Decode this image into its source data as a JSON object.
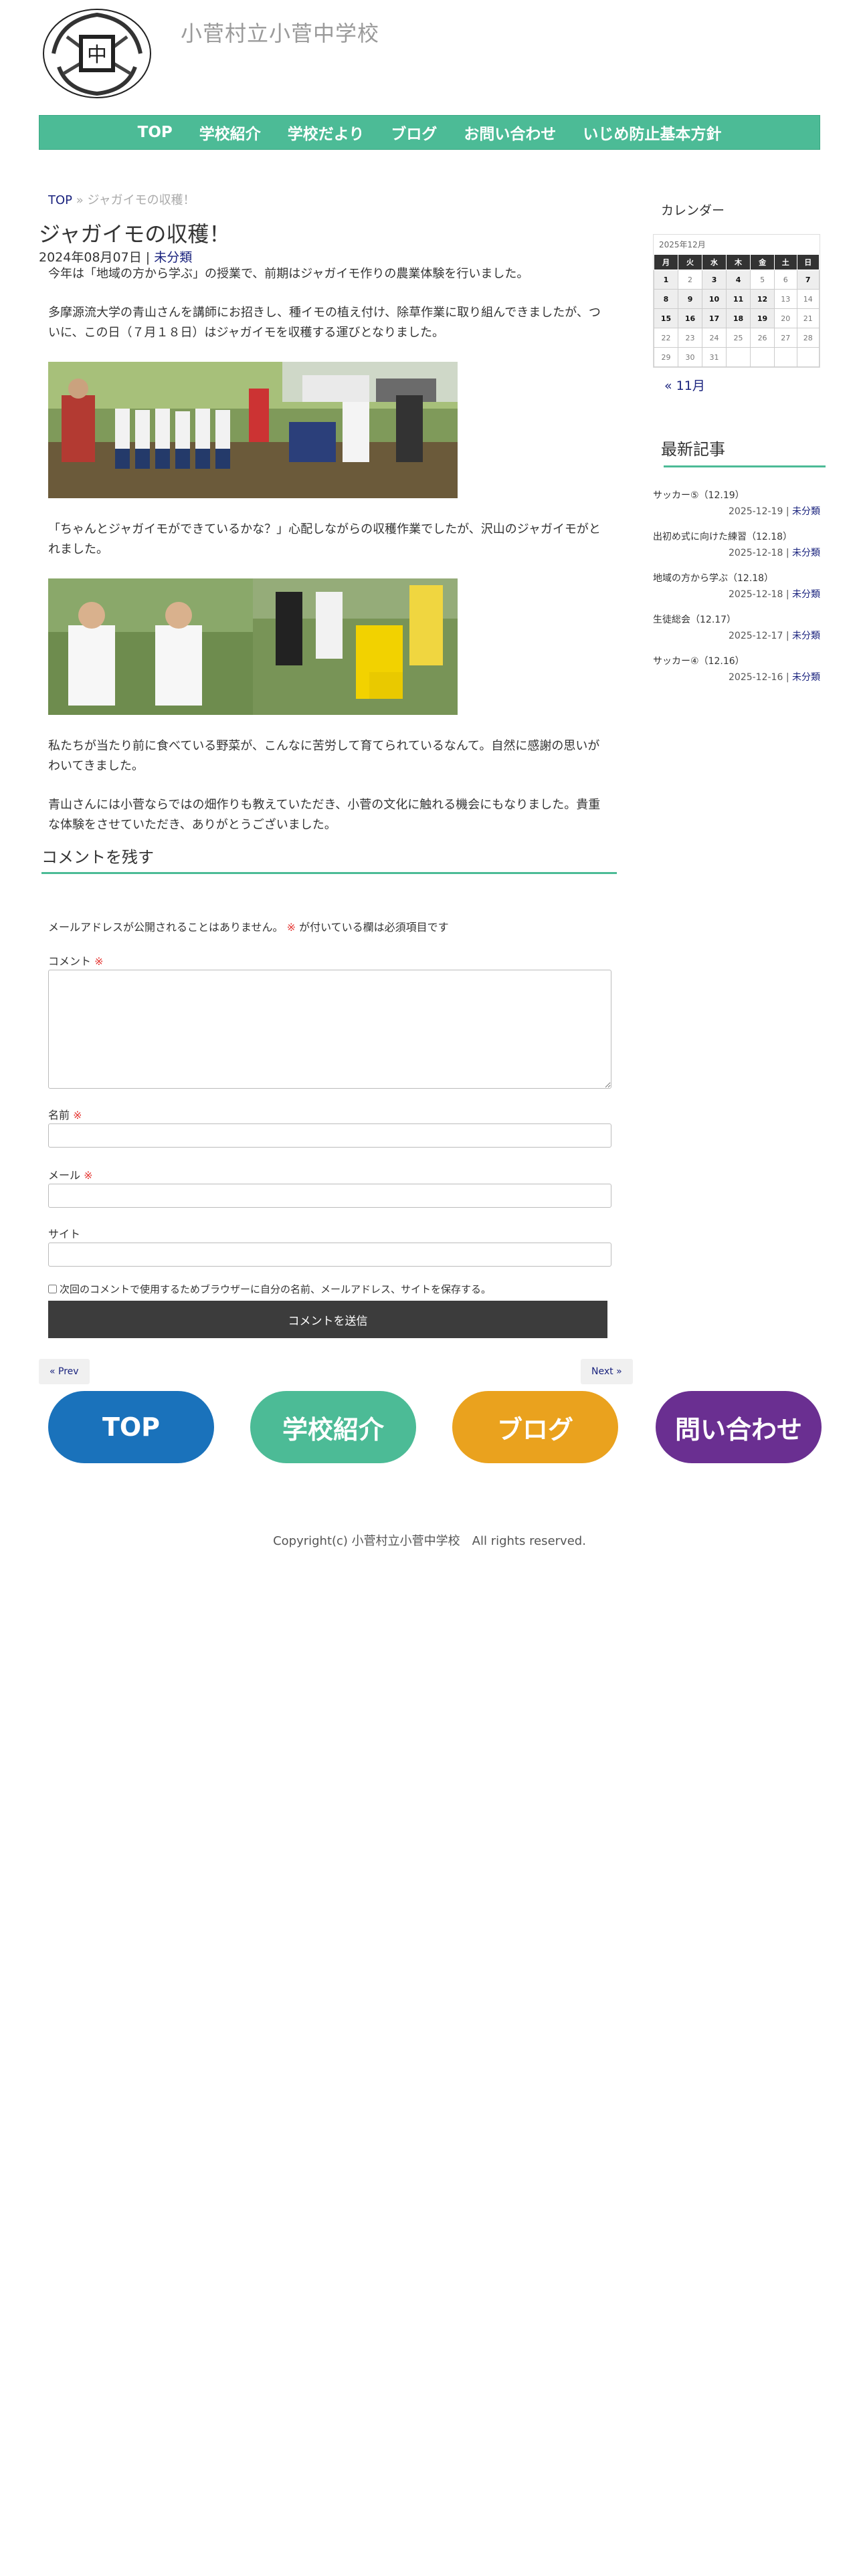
{
  "site": {
    "title": "小菅村立小菅中学校",
    "logo_text": "中"
  },
  "nav": [
    "TOP",
    "学校紹介",
    "学校だより",
    "ブログ",
    "お問い合わせ",
    "いじめ防止基本方針"
  ],
  "breadcrumb": {
    "home": "TOP",
    "sep": "»",
    "current": "ジャガイモの収穫！"
  },
  "post": {
    "title": "ジャガイモの収穫！",
    "date": "2024年08月07日",
    "sep": "|",
    "category": "未分類",
    "paragraphs": [
      "今年は「地域の方から学ぶ」の授業で、前期はジャガイモ作りの農業体験を行いました。",
      "多摩源流大学の青山さんを講師にお招きし、種イモの植え付け、除草作業に取り組んできましたが、ついに、この日（７月１８日）はジャガイモを収穫する運びとなりました。",
      "「ちゃんとジャガイモができているかな？」心配しながらの収穫作業でしたが、沢山のジャガイモがとれました。",
      "私たちが当たり前に食べている野菜が、こんなに苦労して育てられているなんて。自然に感謝の思いがわいてきました。",
      "青山さんには小菅ならではの畑作りも教えていただき、小菅の文化に触れる機会にもなりました。貴重な体験をさせていただき、ありがとうございました。"
    ]
  },
  "comment": {
    "title": "コメントを残す",
    "notes_a": "メールアドレスが公開されることはありません。",
    "req_mark": "※",
    "notes_b": "が付いている欄は必須項目です",
    "comment_label": "コメント",
    "name_label": "名前",
    "email_label": "メール",
    "site_label": "サイト",
    "save_label": "次回のコメントで使用するためブラウザーに自分の名前、メールアドレス、サイトを保存する。",
    "submit": "コメントを送信"
  },
  "pager": {
    "prev": "« Prev",
    "next": "Next »"
  },
  "footer_buttons": [
    {
      "label": "TOP",
      "color": "#1a72bb"
    },
    {
      "label": "学校紹介",
      "color": "#4cbb96"
    },
    {
      "label": "ブログ",
      "color": "#eaa21e"
    },
    {
      "label": "問い合わせ",
      "color": "#6a2f91"
    }
  ],
  "copyright": "Copyright(c) 小菅村立小菅中学校　All rights reserved.",
  "sidebar": {
    "calendar_title": "カレンダー",
    "calendar_caption": "2025年12月",
    "weekdays": [
      "月",
      "火",
      "水",
      "木",
      "金",
      "土",
      "日"
    ],
    "weeks": [
      [
        "1",
        "2",
        "3",
        "4",
        "5",
        "6",
        "7"
      ],
      [
        "8",
        "9",
        "10",
        "11",
        "12",
        "13",
        "14"
      ],
      [
        "15",
        "16",
        "17",
        "18",
        "19",
        "20",
        "21"
      ],
      [
        "22",
        "23",
        "24",
        "25",
        "26",
        "27",
        "28"
      ],
      [
        "29",
        "30",
        "31",
        "",
        "",
        "",
        ""
      ]
    ],
    "linked_days": [
      "1",
      "3",
      "4",
      "7",
      "8",
      "9",
      "10",
      "11",
      "12",
      "15",
      "16",
      "17",
      "18",
      "19"
    ],
    "prev_month": "« 11月",
    "recent_title": "最新記事",
    "recent": [
      {
        "title": "サッカー⑤（12.19）",
        "date": "2025-12-19",
        "cat": "未分類"
      },
      {
        "title": "出初め式に向けた練習（12.18）",
        "date": "2025-12-18",
        "cat": "未分類"
      },
      {
        "title": "地域の方から学ぶ（12.18）",
        "date": "2025-12-18",
        "cat": "未分類"
      },
      {
        "title": "生徒総会（12.17）",
        "date": "2025-12-17",
        "cat": "未分類"
      },
      {
        "title": "サッカー④（12.16）",
        "date": "2025-12-16",
        "cat": "未分類"
      }
    ]
  }
}
